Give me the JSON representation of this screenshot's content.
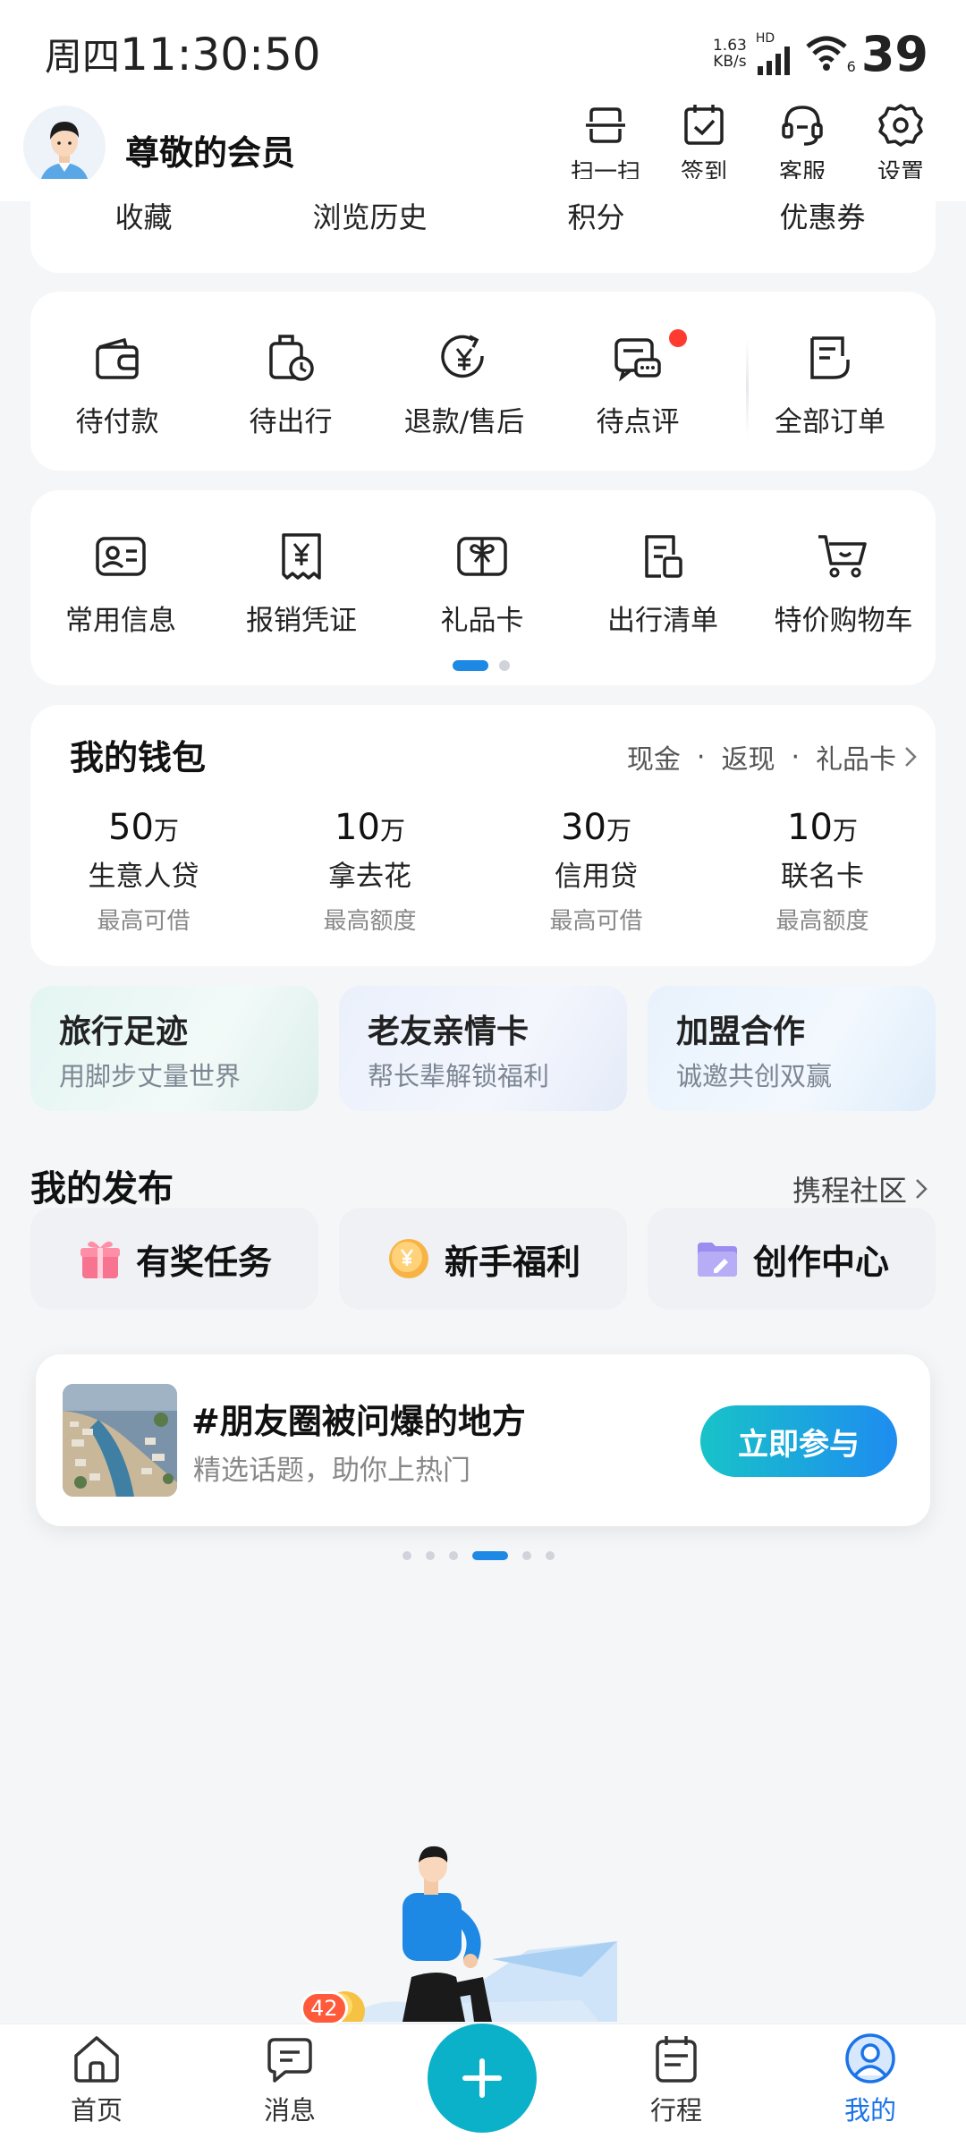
{
  "status": {
    "weekday": "周四",
    "time": "11:30:50",
    "net_speed_value": "1.63",
    "net_speed_unit": "KB/s",
    "hd": "HD",
    "wifi_num": "6",
    "battery": "39"
  },
  "header": {
    "member_name": "尊敬的会员",
    "actions": [
      {
        "label": "扫一扫",
        "icon": "scan-icon"
      },
      {
        "label": "签到",
        "icon": "calendar-check-icon"
      },
      {
        "label": "客服",
        "icon": "headset-icon"
      },
      {
        "label": "设置",
        "icon": "gear-icon"
      }
    ]
  },
  "favorites_row": [
    "收藏",
    "浏览历史",
    "积分",
    "优惠券"
  ],
  "orders": [
    {
      "label": "待付款",
      "icon": "wallet-icon"
    },
    {
      "label": "待出行",
      "icon": "luggage-clock-icon"
    },
    {
      "label": "退款/售后",
      "icon": "refund-icon"
    },
    {
      "label": "待点评",
      "icon": "comment-icon"
    },
    {
      "label": "全部订单",
      "icon": "orders-icon"
    }
  ],
  "tools": [
    {
      "label": "常用信息",
      "icon": "id-card-icon"
    },
    {
      "label": "报销凭证",
      "icon": "receipt-icon"
    },
    {
      "label": "礼品卡",
      "icon": "gift-card-icon"
    },
    {
      "label": "出行清单",
      "icon": "checklist-icon"
    },
    {
      "label": "特价购物车",
      "icon": "cart-icon"
    }
  ],
  "wallet": {
    "title": "我的钱包",
    "links": [
      "现金",
      "返现",
      "礼品卡"
    ],
    "items": [
      {
        "amount": "50",
        "unit": "万",
        "name": "生意人贷",
        "sub": "最高可借"
      },
      {
        "amount": "10",
        "unit": "万",
        "name": "拿去花",
        "sub": "最高额度"
      },
      {
        "amount": "30",
        "unit": "万",
        "name": "信用贷",
        "sub": "最高可借"
      },
      {
        "amount": "10",
        "unit": "万",
        "name": "联名卡",
        "sub": "最高额度"
      }
    ]
  },
  "promos": [
    {
      "title": "旅行足迹",
      "sub": "用脚步丈量世界"
    },
    {
      "title": "老友亲情卡",
      "sub": "帮长辈解锁福利"
    },
    {
      "title": "加盟合作",
      "sub": "诚邀共创双赢"
    }
  ],
  "publish": {
    "title": "我的发布",
    "community": "携程社区",
    "buttons": [
      {
        "label": "有奖任务",
        "icon": "gift-icon"
      },
      {
        "label": "新手福利",
        "icon": "coin-icon"
      },
      {
        "label": "创作中心",
        "icon": "folder-edit-icon"
      }
    ]
  },
  "topic": {
    "title": "#朋友圈被问爆的地方",
    "sub": "精选话题，助你上热门",
    "button": "立即参与"
  },
  "nav": {
    "items": [
      {
        "label": "首页",
        "icon": "home-icon"
      },
      {
        "label": "消息",
        "icon": "message-icon"
      },
      {
        "label": "行程",
        "icon": "itinerary-icon"
      },
      {
        "label": "我的",
        "icon": "profile-icon"
      }
    ],
    "message_badge": "42"
  },
  "colors": {
    "accent": "#1a73e8",
    "fab": "#0ab1c8",
    "badge": "#ff5a3c",
    "red_dot": "#ff3b30"
  }
}
